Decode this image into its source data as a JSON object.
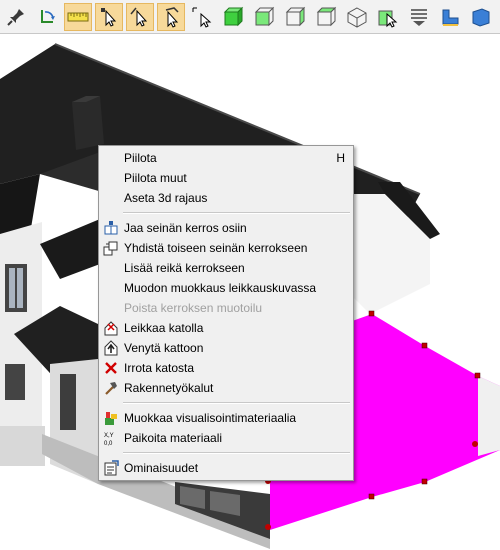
{
  "toolbar": {
    "tools": [
      {
        "icon": "pin-icon",
        "active": false
      },
      {
        "icon": "rotate-icon",
        "active": false
      },
      {
        "icon": "ruler-icon",
        "active": true
      },
      {
        "icon": "select-point-icon",
        "active": true
      },
      {
        "icon": "select-line-icon",
        "active": true
      },
      {
        "icon": "select-polygon-icon",
        "active": true
      },
      {
        "icon": "select-cursor-icon",
        "active": false
      },
      {
        "icon": "green-cube-icon",
        "active": false
      },
      {
        "icon": "box-front-icon",
        "active": false
      },
      {
        "icon": "box-side-icon",
        "active": false
      },
      {
        "icon": "box-back-icon",
        "active": false
      },
      {
        "icon": "box-iso-icon",
        "active": false
      },
      {
        "icon": "box-select-icon",
        "active": false
      },
      {
        "icon": "layers-icon",
        "active": false
      },
      {
        "icon": "chair-icon",
        "active": false
      },
      {
        "icon": "blue-shape-icon",
        "active": false
      }
    ]
  },
  "context_menu": {
    "items": [
      {
        "label": "Piilota",
        "shortcut": "H"
      },
      {
        "label": "Piilota muut"
      },
      {
        "label": "Aseta 3d rajaus"
      },
      {
        "label": "Jaa seinän kerros osiin",
        "icon": "split-layer-icon"
      },
      {
        "label": "Yhdistä toiseen seinän kerrokseen",
        "icon": "merge-layer-icon"
      },
      {
        "label": "Lisää reikä kerrokseen"
      },
      {
        "label": "Muodon muokkaus leikkauskuvassa"
      },
      {
        "label": "Poista kerroksen muotoilu",
        "disabled": true
      },
      {
        "label": "Leikkaa katolla",
        "icon": "cut-roof-icon"
      },
      {
        "label": "Venytä kattoon",
        "icon": "extend-roof-icon"
      },
      {
        "label": "Irrota katosta",
        "icon": "detach-roof-icon"
      },
      {
        "label": "Rakennetyökalut",
        "icon": "hammer-icon"
      },
      {
        "label": "Muokkaa visualisointimateriaalia",
        "icon": "paint-bucket-icon"
      },
      {
        "label": "Paikoita materiaali",
        "icon": "xyz-icon"
      },
      {
        "label": "Ominaisuudet",
        "icon": "properties-icon"
      }
    ]
  },
  "colors": {
    "selection": "#ff00ff",
    "handle": "#c00000",
    "toolbar_active": "#f7d99a",
    "roof": "#1c1c1c"
  }
}
